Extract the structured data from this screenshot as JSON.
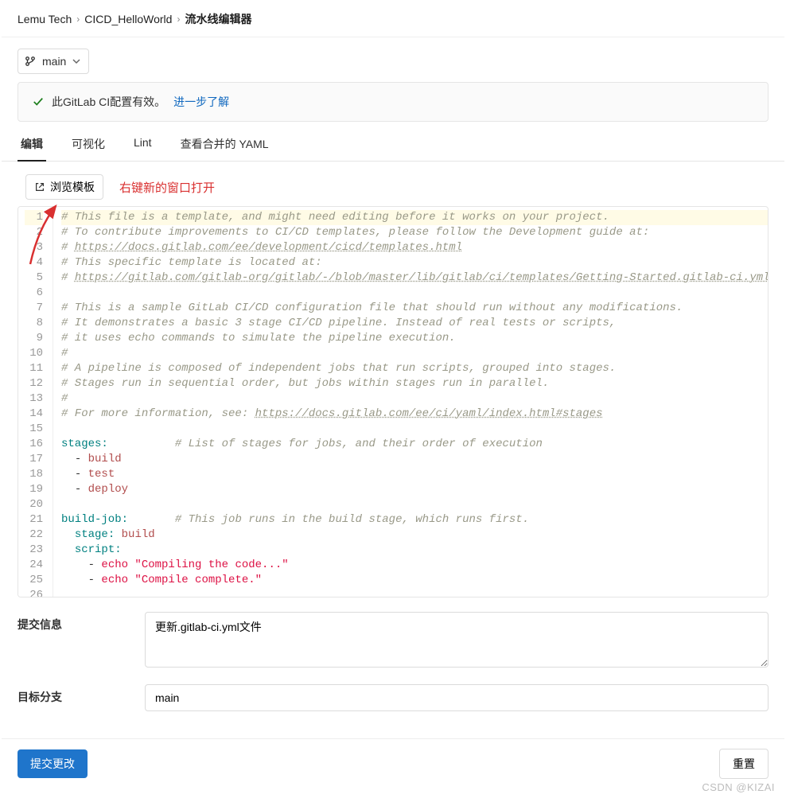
{
  "breadcrumb": {
    "group": "Lemu Tech",
    "project": "CICD_HelloWorld",
    "page": "流水线编辑器"
  },
  "branch": {
    "name": "main"
  },
  "banner": {
    "text": "此GitLab CI配置有效。",
    "link_text": "进一步了解"
  },
  "tabs": {
    "edit": "编辑",
    "visualize": "可视化",
    "lint": "Lint",
    "merged": "查看合并的 YAML"
  },
  "toolbar": {
    "browse_templates": "浏览模板",
    "annotation": "右键新的窗口打开"
  },
  "editor_lines": [
    {
      "t": "comment",
      "text": "# This file is a template, and might need editing before it works on your project."
    },
    {
      "t": "comment",
      "text": "# To contribute improvements to CI/CD templates, please follow the Development guide at:"
    },
    {
      "t": "link",
      "prefix": "# ",
      "url": "https://docs.gitlab.com/ee/development/cicd/templates.html"
    },
    {
      "t": "comment",
      "text": "# This specific template is located at:"
    },
    {
      "t": "link",
      "prefix": "# ",
      "url": "https://gitlab.com/gitlab-org/gitlab/-/blob/master/lib/gitlab/ci/templates/Getting-Started.gitlab-ci.yml"
    },
    {
      "t": "blank",
      "text": ""
    },
    {
      "t": "comment",
      "text": "# This is a sample GitLab CI/CD configuration file that should run without any modifications."
    },
    {
      "t": "comment",
      "text": "# It demonstrates a basic 3 stage CI/CD pipeline. Instead of real tests or scripts,"
    },
    {
      "t": "comment",
      "text": "# it uses echo commands to simulate the pipeline execution."
    },
    {
      "t": "comment",
      "text": "#"
    },
    {
      "t": "comment",
      "text": "# A pipeline is composed of independent jobs that run scripts, grouped into stages."
    },
    {
      "t": "comment",
      "text": "# Stages run in sequential order, but jobs within stages run in parallel."
    },
    {
      "t": "comment",
      "text": "#"
    },
    {
      "t": "link",
      "prefix": "# For more information, see: ",
      "url": "https://docs.gitlab.com/ee/ci/yaml/index.html#stages"
    },
    {
      "t": "blank",
      "text": ""
    },
    {
      "t": "keycomment",
      "key": "stages:",
      "comment": "          # List of stages for jobs, and their order of execution"
    },
    {
      "t": "listitem",
      "indent": "  ",
      "value": "build"
    },
    {
      "t": "listitem",
      "indent": "  ",
      "value": "test"
    },
    {
      "t": "listitem",
      "indent": "  ",
      "value": "deploy"
    },
    {
      "t": "blank",
      "text": ""
    },
    {
      "t": "keycomment",
      "key": "build-job:",
      "comment": "       # This job runs in the build stage, which runs first."
    },
    {
      "t": "kv",
      "indent": "  ",
      "key": "stage:",
      "value": " build"
    },
    {
      "t": "key",
      "indent": "  ",
      "key": "script:"
    },
    {
      "t": "liststr",
      "indent": "    ",
      "value": "echo \"Compiling the code...\""
    },
    {
      "t": "liststr",
      "indent": "    ",
      "value": "echo \"Compile complete.\""
    },
    {
      "t": "blank",
      "text": ""
    }
  ],
  "form": {
    "commit_message_label": "提交信息",
    "commit_message_value": "更新.gitlab-ci.yml文件",
    "target_branch_label": "目标分支",
    "target_branch_value": "main"
  },
  "buttons": {
    "submit": "提交更改",
    "reset": "重置"
  },
  "watermark": "CSDN @KIZAI"
}
